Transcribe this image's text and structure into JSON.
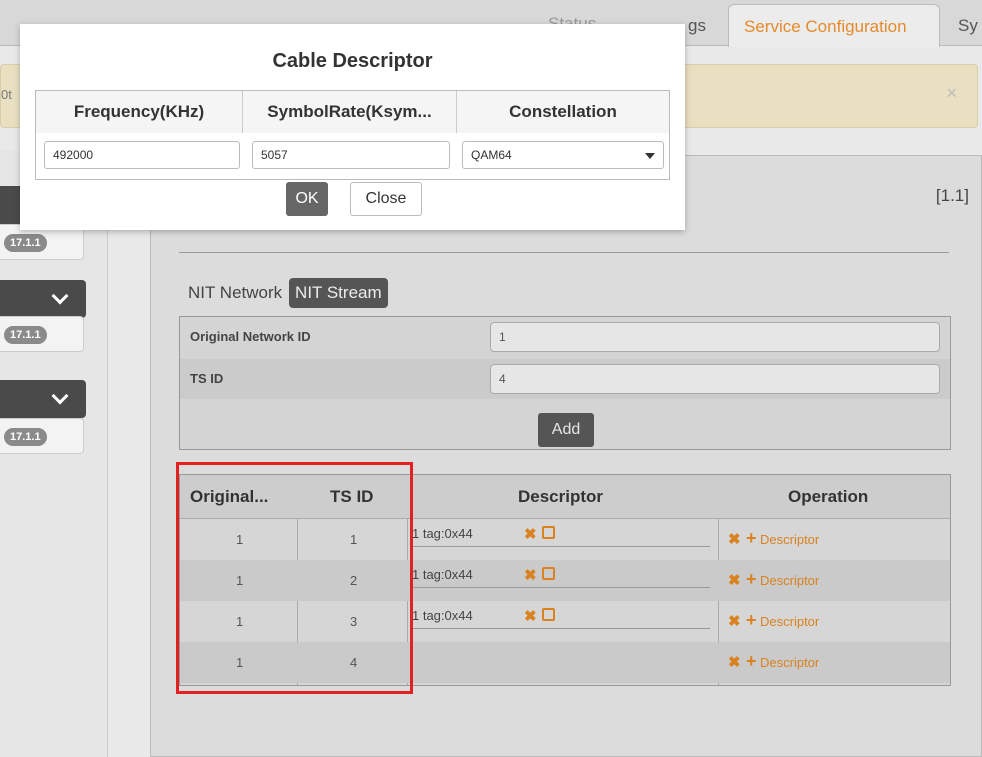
{
  "topnav": {
    "status_fragment": "Status",
    "settings_fragment": "gs",
    "active_tab": "Service Configuration",
    "next_tab_fragment": "Sy"
  },
  "alert": {
    "fragment": "0t",
    "close": "×"
  },
  "sidebar": {
    "badges": [
      "17.1.1",
      "17.1.1",
      "17.1.1"
    ]
  },
  "panel": {
    "version": "[1.1]",
    "subtabs": [
      "NIT Network",
      "NIT Stream"
    ],
    "form": {
      "original_network_id_label": "Original Network ID",
      "original_network_id_value": "1",
      "ts_id_label": "TS ID",
      "ts_id_value": "4",
      "add_label": "Add"
    },
    "grid": {
      "headers": [
        "Original...",
        "TS ID",
        "Descriptor",
        "Operation"
      ],
      "rows": [
        {
          "original": "1",
          "ts_id": "1",
          "descriptor": "1 tag:0x44",
          "op": "Descriptor"
        },
        {
          "original": "1",
          "ts_id": "2",
          "descriptor": "1 tag:0x44",
          "op": "Descriptor"
        },
        {
          "original": "1",
          "ts_id": "3",
          "descriptor": "1 tag:0x44",
          "op": "Descriptor"
        },
        {
          "original": "1",
          "ts_id": "4",
          "descriptor": "",
          "op": "Descriptor"
        }
      ]
    }
  },
  "modal": {
    "title": "Cable Descriptor",
    "headers": [
      "Frequency(KHz)",
      "SymbolRate(Ksym...",
      "Constellation"
    ],
    "frequency": "492000",
    "symbol_rate": "5057",
    "constellation": "QAM64",
    "ok_label": "OK",
    "close_label": "Close"
  },
  "colors": {
    "accent": "#e58a2a",
    "highlight": "#e52020"
  }
}
